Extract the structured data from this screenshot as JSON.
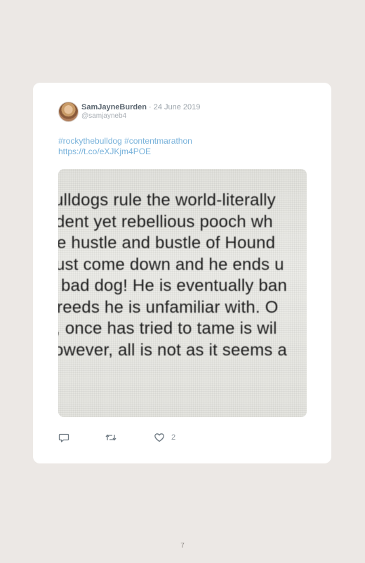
{
  "tweet": {
    "author_name": "SamJayneBurden",
    "separator": "·",
    "date": "24 June 2019",
    "handle": "@samjayneb4",
    "text_line1": "#rockythebulldog #contentmarathon",
    "text_line2": "https://t.co/eXJKjm4POE",
    "photo_text": [
      "ulldogs rule the world-literally",
      "dent yet rebellious pooch wh",
      "e hustle and bustle of Hound",
      "ust come down and he ends u",
      "bad dog! He is eventually ban",
      "reeds he is unfamiliar with. O",
      ", once has tried to tame is wil",
      "owever, all is not as it seems a"
    ],
    "like_count": "2",
    "icons": {
      "reply": "reply-icon",
      "retweet": "retweet-icon",
      "like": "heart-icon"
    }
  },
  "page": {
    "number": "7"
  }
}
